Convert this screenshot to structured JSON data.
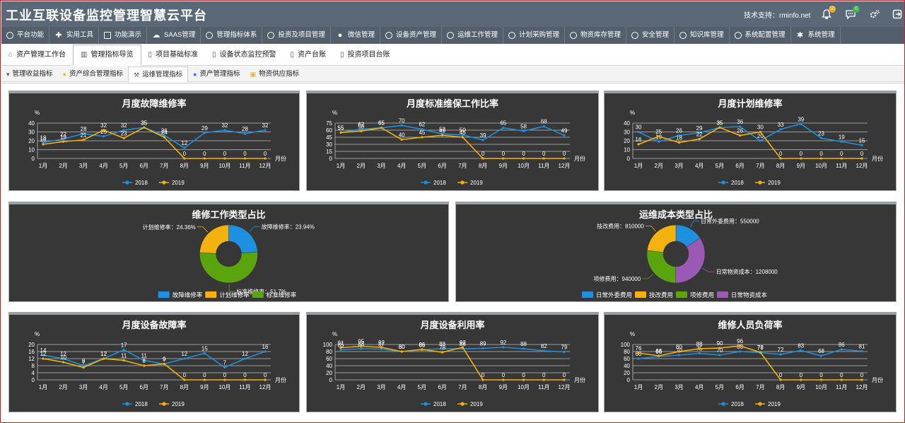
{
  "header": {
    "title": "工业互联设备监控管理智慧云平台",
    "support_label": "技术支持：",
    "support_site": "rminfo.net",
    "bell_badge": "10",
    "chat_badge": "0"
  },
  "nav": [
    {
      "label": "平台功能",
      "icon": "circle-icon"
    },
    {
      "label": "实用工具",
      "icon": "tools-icon"
    },
    {
      "label": "功能演示",
      "icon": "square-icon"
    },
    {
      "label": "SAAS管理",
      "icon": "cloud-icon"
    },
    {
      "label": "管理指标体系",
      "icon": "circle-icon"
    },
    {
      "label": "投资及项目管理",
      "icon": "circle-icon"
    },
    {
      "label": "微信管理",
      "icon": "wechat-icon"
    },
    {
      "label": "设备资产管理",
      "icon": "circle-icon"
    },
    {
      "label": "运维工作管理",
      "icon": "circle-icon"
    },
    {
      "label": "计划采购管理",
      "icon": "circle-icon"
    },
    {
      "label": "物资库存管理",
      "icon": "circle-icon"
    },
    {
      "label": "安全管理",
      "icon": "circle-icon"
    },
    {
      "label": "知识库管理",
      "icon": "circle-icon"
    },
    {
      "label": "系统配置管理",
      "icon": "circle-icon"
    },
    {
      "label": "系统管理",
      "icon": "gear-icon"
    }
  ],
  "tabs1": [
    {
      "label": "资产管理工作台",
      "active": false
    },
    {
      "label": "管理指标导览",
      "active": true
    },
    {
      "label": "项目基础标准",
      "active": false
    },
    {
      "label": "设备状态监控预警",
      "active": false
    },
    {
      "label": "资产台账",
      "active": false
    },
    {
      "label": "投资项目台账",
      "active": false
    }
  ],
  "tabs2": [
    {
      "label": "管理收益指标",
      "active": false
    },
    {
      "label": "资产综合管理指标",
      "active": false
    },
    {
      "label": "运维管理指标",
      "active": true
    },
    {
      "label": "资产管理指标",
      "active": false
    },
    {
      "label": "物资供应指标",
      "active": false
    }
  ],
  "colors": {
    "s2018": "#1e90e0",
    "s2019": "#f3b20f"
  },
  "chart_data": [
    {
      "type": "line",
      "title": "月度故障维修率",
      "ylabel": "%",
      "xlabel": "月份",
      "categories": [
        "1月",
        "2月",
        "3月",
        "4月",
        "5月",
        "6月",
        "7月",
        "8月",
        "9月",
        "10月",
        "11月",
        "12月"
      ],
      "ylim": [
        0,
        40
      ],
      "yticks": [
        0,
        10,
        20,
        30,
        40
      ],
      "series": [
        {
          "name": "2018",
          "values": [
            18,
            22,
            28,
            25,
            32,
            35,
            26,
            12,
            29,
            32,
            28,
            32
          ]
        },
        {
          "name": "2019",
          "values": [
            16,
            19,
            21,
            32,
            23,
            35,
            24,
            0,
            0,
            0,
            0,
            0
          ]
        }
      ]
    },
    {
      "type": "line",
      "title": "月度标准维保工作比率",
      "ylabel": "%",
      "xlabel": "月份",
      "categories": [
        "1月",
        "2月",
        "3月",
        "4月",
        "5月",
        "6月",
        "7月",
        "8月",
        "9月",
        "10月",
        "11月",
        "12月"
      ],
      "ylim": [
        0,
        75
      ],
      "yticks": [
        0,
        15,
        30,
        45,
        60,
        75
      ],
      "series": [
        {
          "name": "2018",
          "values": [
            55,
            62,
            65,
            70,
            62,
            52,
            50,
            39,
            65,
            58,
            68,
            49
          ]
        },
        {
          "name": "2019",
          "values": [
            55,
            58,
            65,
            40,
            45,
            49,
            45,
            0,
            0,
            0,
            0,
            0
          ]
        }
      ]
    },
    {
      "type": "line",
      "title": "月度计划维修率",
      "ylabel": "%",
      "xlabel": "月份",
      "categories": [
        "1月",
        "2月",
        "3月",
        "4月",
        "5月",
        "6月",
        "7月",
        "8月",
        "9月",
        "10月",
        "11月",
        "12月"
      ],
      "ylim": [
        0,
        40
      ],
      "yticks": [
        0,
        10,
        20,
        30,
        40
      ],
      "series": [
        {
          "name": "2018",
          "values": [
            30,
            19,
            26,
            29,
            35,
            36,
            20,
            33,
            39,
            23,
            19,
            15
          ]
        },
        {
          "name": "2019",
          "values": [
            16,
            25,
            18,
            22,
            35,
            26,
            30,
            0,
            0,
            0,
            0,
            0
          ]
        }
      ]
    },
    {
      "type": "pie",
      "title": "维修工作类型占比",
      "slices": [
        {
          "name": "故障维修率",
          "value": 23.94,
          "label": "故障维修率：23.94%",
          "color": "#1e90e0"
        },
        {
          "name": "标准维修率",
          "value": 51.7,
          "label": "标准维修率：51.7%",
          "color": "#5aa50e"
        },
        {
          "name": "计划维修率",
          "value": 24.36,
          "label": "计划维修率：24.36%",
          "color": "#f3b20f"
        }
      ],
      "legend": [
        "故障维修率",
        "计划维修率",
        "标准维修率"
      ]
    },
    {
      "type": "pie",
      "title": "运维成本类型占比",
      "slices": [
        {
          "name": "日常外委费用",
          "value": 550000,
          "label": "日常外委费用：550000",
          "color": "#1e90e0"
        },
        {
          "name": "日常物资成本",
          "value": 1208000,
          "label": "日常物资成本：1208000",
          "color": "#9b59b6"
        },
        {
          "name": "项修费用",
          "value": 940000,
          "label": "项修费用：940000",
          "color": "#5aa50e"
        },
        {
          "name": "技改费用",
          "value": 810000,
          "label": "技改费用：810000",
          "color": "#f3b20f"
        }
      ],
      "legend": [
        "日常外委费用",
        "技改费用",
        "项修费用",
        "日常物资成本"
      ]
    },
    {
      "type": "line",
      "title": "月度设备故障率",
      "ylabel": "%",
      "xlabel": "月份",
      "categories": [
        "1月",
        "2月",
        "3月",
        "4月",
        "5月",
        "6月",
        "7月",
        "8月",
        "9月",
        "10月",
        "11月",
        "12月"
      ],
      "ylim": [
        0,
        20
      ],
      "yticks": [
        0,
        4,
        8,
        12,
        16,
        20
      ],
      "series": [
        {
          "name": "2018",
          "values": [
            14,
            12,
            8,
            12,
            17,
            11,
            9,
            12,
            15,
            7,
            12,
            16
          ]
        },
        {
          "name": "2019",
          "values": [
            12,
            10,
            7,
            12,
            11,
            8,
            9,
            0,
            0,
            0,
            0,
            0
          ]
        }
      ]
    },
    {
      "type": "line",
      "title": "月度设备利用率",
      "ylabel": "%",
      "xlabel": "月份",
      "categories": [
        "1月",
        "2月",
        "3月",
        "4月",
        "5月",
        "6月",
        "7月",
        "8月",
        "9月",
        "10月",
        "11月",
        "12月"
      ],
      "ylim": [
        0,
        100
      ],
      "yticks": [
        0,
        20,
        40,
        60,
        80,
        100
      ],
      "series": [
        {
          "name": "2018",
          "values": [
            85,
            88,
            87,
            80,
            85,
            88,
            88,
            89,
            92,
            88,
            82,
            79
          ]
        },
        {
          "name": "2019",
          "values": [
            91,
            95,
            92,
            80,
            86,
            78,
            92,
            0,
            0,
            0,
            0,
            0
          ]
        }
      ]
    },
    {
      "type": "line",
      "title": "维修人员负荷率",
      "ylabel": "%",
      "xlabel": "月份",
      "categories": [
        "1月",
        "2月",
        "3月",
        "4月",
        "5月",
        "6月",
        "7月",
        "8月",
        "9月",
        "10月",
        "11月",
        "12月"
      ],
      "ylim": [
        0,
        100
      ],
      "yticks": [
        0,
        20,
        40,
        60,
        80,
        100
      ],
      "series": [
        {
          "name": "2018",
          "values": [
            60,
            66,
            70,
            75,
            70,
            80,
            77,
            72,
            83,
            68,
            86,
            81
          ]
        },
        {
          "name": "2019",
          "values": [
            76,
            68,
            80,
            88,
            90,
            96,
            78,
            0,
            0,
            0,
            0,
            0
          ]
        }
      ]
    }
  ]
}
